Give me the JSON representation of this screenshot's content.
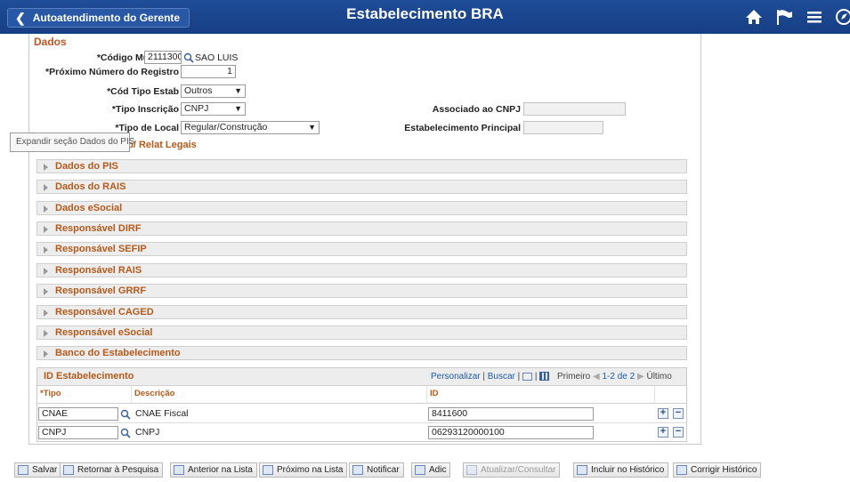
{
  "header": {
    "back_label": "Autoatendimento do Gerente",
    "title": "Estabelecimento BRA",
    "icons": [
      "home-icon",
      "flag-icon",
      "menu-icon",
      "compass-icon"
    ]
  },
  "section": {
    "title": "Dados"
  },
  "form": {
    "municipio_label": "*Código Município",
    "municipio_value": "2111300",
    "municipio_desc": "SAO LUIS",
    "registro_label": "*Próximo Número do Registro",
    "registro_value": "1",
    "tipo_estab_label": "*Cód Tipo Estab",
    "tipo_estab_value": "Outros",
    "tipo_insc_label": "*Tipo Inscrição",
    "tipo_insc_value": "CNPJ",
    "associado_label": "Associado ao CNPJ",
    "associado_value": "",
    "tipo_local_label": "*Tipo de Local",
    "tipo_local_value": "Regular/Construção",
    "principal_label": "Estabelecimento Principal",
    "principal_value": ""
  },
  "tooltip": "Expandir seção Dados do PIS",
  "sections": [
    "Nome Empresa p/ Relat Legais",
    "Dados do PIS",
    "Dados do RAIS",
    "Dados eSocial",
    "Responsável DIRF",
    "Responsável SEFIP",
    "Responsável RAIS",
    "Responsável GRRF",
    "Responsável CAGED",
    "Responsável eSocial",
    "Banco do Estabelecimento"
  ],
  "grid": {
    "title": "ID Estabelecimento",
    "personalizar": "Personalizar",
    "buscar": "Buscar",
    "primeiro": "Primeiro",
    "range": "1-2 de 2",
    "ultimo": "Último",
    "columns": [
      "*Tipo",
      "Descrição",
      "ID"
    ],
    "rows": [
      {
        "tipo": "CNAE",
        "descricao": "CNAE Fiscal",
        "id": "8411600"
      },
      {
        "tipo": "CNPJ",
        "descricao": "CNPJ",
        "id": "06293120000100"
      }
    ]
  },
  "toolbar": [
    {
      "label": "Salvar",
      "enabled": true
    },
    {
      "label": "Retornar à Pesquisa",
      "enabled": true
    },
    {
      "label": "Anterior na Lista",
      "enabled": true
    },
    {
      "label": "Próximo na Lista",
      "enabled": true
    },
    {
      "label": "Notificar",
      "enabled": true
    },
    {
      "label": "Adic",
      "enabled": true
    },
    {
      "label": "Atualizar/Consultar",
      "enabled": false
    },
    {
      "label": "Incluir no Histórico",
      "enabled": true
    },
    {
      "label": "Corrigir Histórico",
      "enabled": true
    }
  ]
}
